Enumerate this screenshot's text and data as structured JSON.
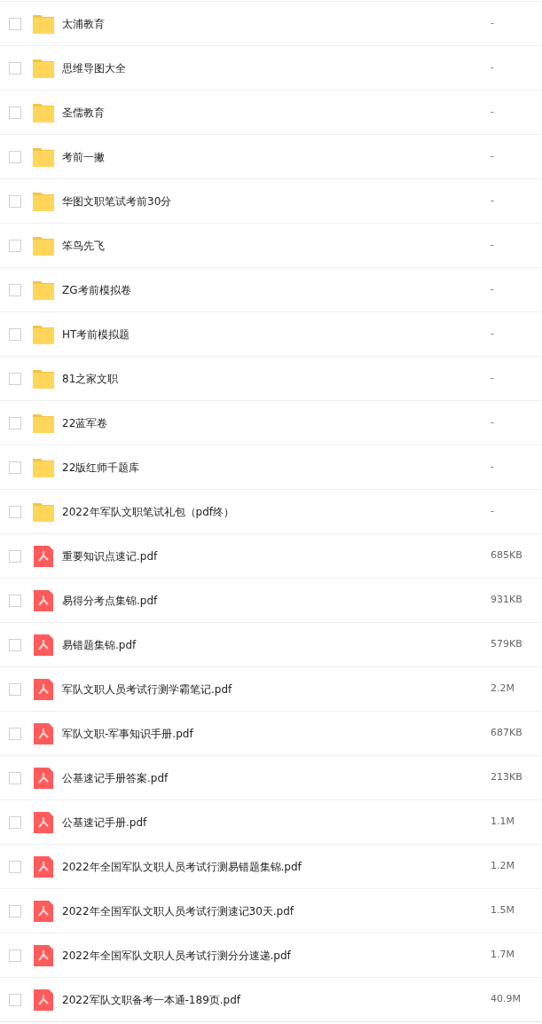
{
  "files": [
    {
      "kind": "folder",
      "name": "太浦教育",
      "size": "-",
      "checked": false
    },
    {
      "kind": "folder",
      "name": "思维导图大全",
      "size": "-",
      "checked": false
    },
    {
      "kind": "folder",
      "name": "圣儒教育",
      "size": "-",
      "checked": false
    },
    {
      "kind": "folder",
      "name": "考前一撇",
      "size": "-",
      "checked": false
    },
    {
      "kind": "folder",
      "name": "华图文职笔试考前30分",
      "size": "-",
      "checked": false
    },
    {
      "kind": "folder",
      "name": "笨鸟先飞",
      "size": "-",
      "checked": false
    },
    {
      "kind": "folder",
      "name": "ZG考前模拟卷",
      "size": "-",
      "checked": false
    },
    {
      "kind": "folder",
      "name": "HT考前模拟题",
      "size": "-",
      "checked": false
    },
    {
      "kind": "folder",
      "name": "81之家文职",
      "size": "-",
      "checked": false
    },
    {
      "kind": "folder",
      "name": "22蓝军卷",
      "size": "-",
      "checked": false
    },
    {
      "kind": "folder",
      "name": "22版红师千题库",
      "size": "-",
      "checked": false
    },
    {
      "kind": "folder",
      "name": "2022年军队文职笔试礼包（pdf终）",
      "size": "-",
      "checked": false
    },
    {
      "kind": "pdf",
      "name": "重要知识点速记.pdf",
      "size": "685KB",
      "checked": false
    },
    {
      "kind": "pdf",
      "name": "易得分考点集锦.pdf",
      "size": "931KB",
      "checked": false
    },
    {
      "kind": "pdf",
      "name": "易错题集锦.pdf",
      "size": "579KB",
      "checked": false
    },
    {
      "kind": "pdf",
      "name": "军队文职人员考试行测学霸笔记.pdf",
      "size": "2.2M",
      "checked": false
    },
    {
      "kind": "pdf",
      "name": "军队文职-军事知识手册.pdf",
      "size": "687KB",
      "checked": false
    },
    {
      "kind": "pdf",
      "name": "公基速记手册答案.pdf",
      "size": "213KB",
      "checked": false
    },
    {
      "kind": "pdf",
      "name": "公基速记手册.pdf",
      "size": "1.1M",
      "checked": false
    },
    {
      "kind": "pdf",
      "name": "2022年全国军队文职人员考试行测易错题集锦.pdf",
      "size": "1.2M",
      "checked": false
    },
    {
      "kind": "pdf",
      "name": "2022年全国军队文职人员考试行测速记30天.pdf",
      "size": "1.5M",
      "checked": false
    },
    {
      "kind": "pdf",
      "name": "2022年全国军队文职人员考试行测分分速递.pdf",
      "size": "1.7M",
      "checked": false
    },
    {
      "kind": "pdf",
      "name": "2022军队文职备考一本通-189页.pdf",
      "size": "40.9M",
      "checked": false
    }
  ]
}
